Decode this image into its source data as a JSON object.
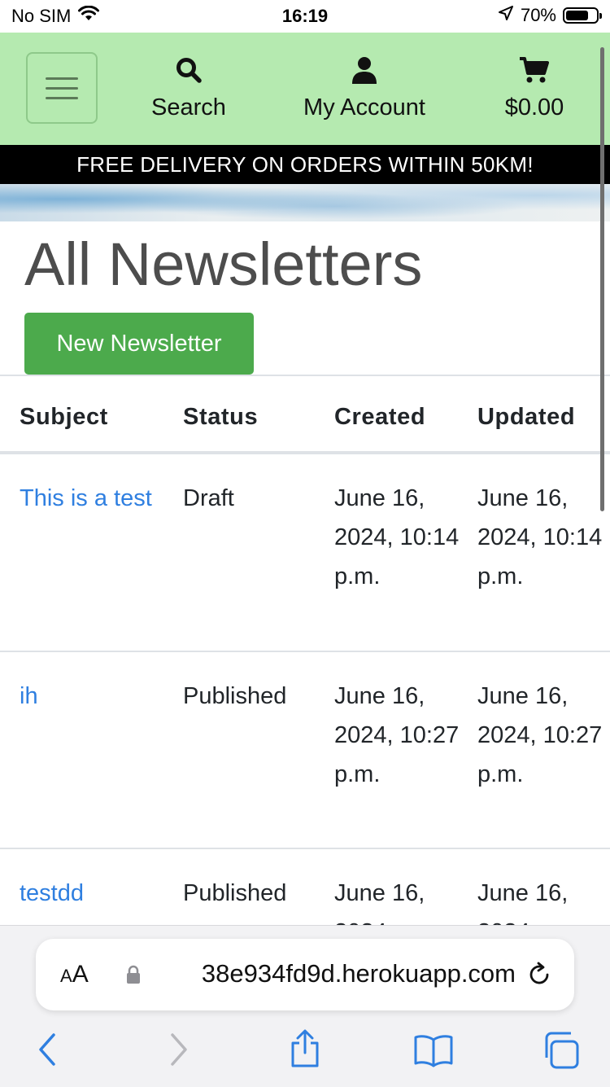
{
  "status_bar": {
    "carrier": "No SIM",
    "time": "16:19",
    "battery": "70%"
  },
  "navbar": {
    "search_label": "Search",
    "account_label": "My Account",
    "cart_label": "$0.00"
  },
  "banner": "FREE DELIVERY ON ORDERS WITHIN 50KM!",
  "page_title": "All Newsletters",
  "new_button": "New Newsletter",
  "table": {
    "headers": [
      "Subject",
      "Status",
      "Created",
      "Updated"
    ],
    "rows": [
      {
        "subject": "This is a test",
        "status": "Draft",
        "created": "June 16, 2024, 10:14 p.m.",
        "updated": "June 16, 2024, 10:14 p.m."
      },
      {
        "subject": "ih",
        "status": "Published",
        "created": "June 16, 2024, 10:27 p.m.",
        "updated": "June 16, 2024, 10:27 p.m."
      },
      {
        "subject": "testdd",
        "status": "Published",
        "created": "June 16, 2024,",
        "updated": "June 16, 2024,"
      }
    ]
  },
  "browser": {
    "text_size_label": "AA",
    "url": "38e934fd9d.herokuapp.com"
  },
  "colors": {
    "navbar_bg": "#b5eab0",
    "button_green": "#4caa4c",
    "link_blue": "#2f7fe0"
  }
}
